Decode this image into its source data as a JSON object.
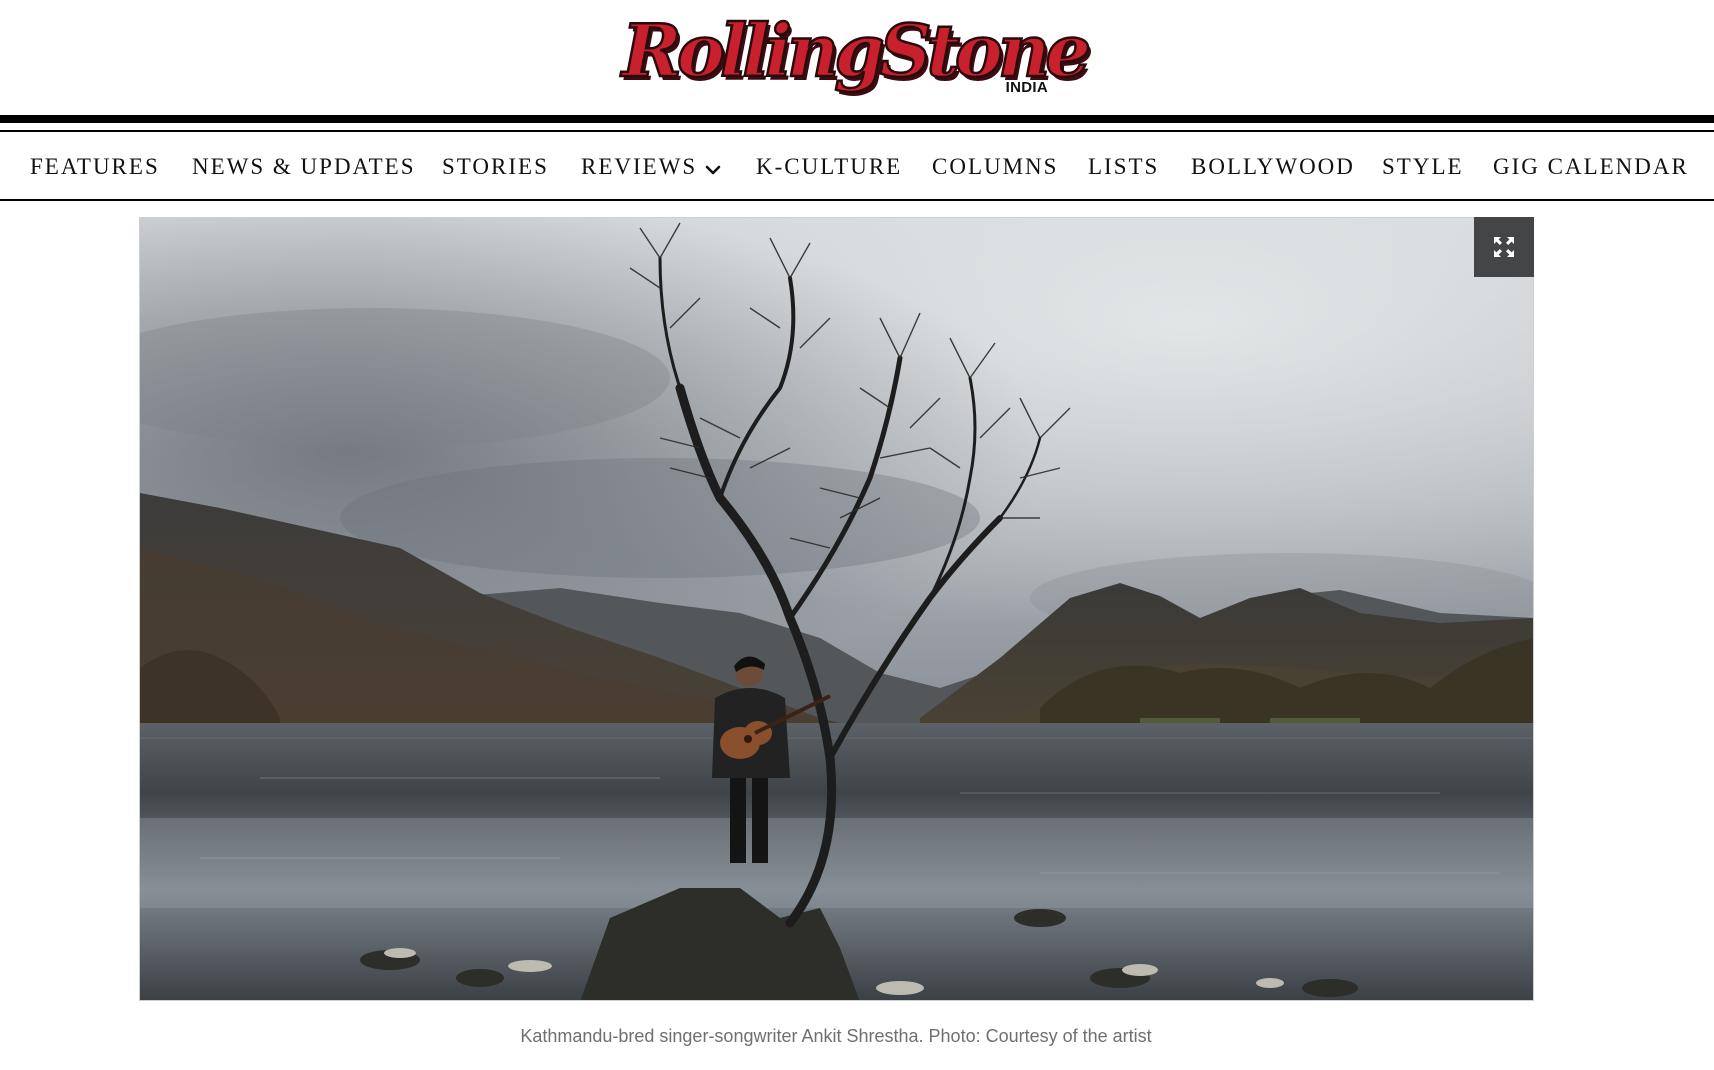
{
  "brand": {
    "logo_text": "RollingStone",
    "edition": "INDIA",
    "logo_color": "#c8202d"
  },
  "nav": {
    "items": [
      {
        "label": "FEATURES"
      },
      {
        "label": "NEWS & UPDATES"
      },
      {
        "label": "STORIES"
      },
      {
        "label": "REVIEWS",
        "has_dropdown": true,
        "icon": "chevron-down-icon"
      },
      {
        "label": "K-CULTURE"
      },
      {
        "label": "COLUMNS"
      },
      {
        "label": "LISTS"
      },
      {
        "label": "BOLLYWOOD"
      },
      {
        "label": "STYLE"
      },
      {
        "label": "GIG CALENDAR"
      }
    ]
  },
  "hero": {
    "expand_icon": "expand-icon",
    "caption": "Kathmandu-bred singer-songwriter Ankit Shrestha. Photo: Courtesy of the artist"
  }
}
